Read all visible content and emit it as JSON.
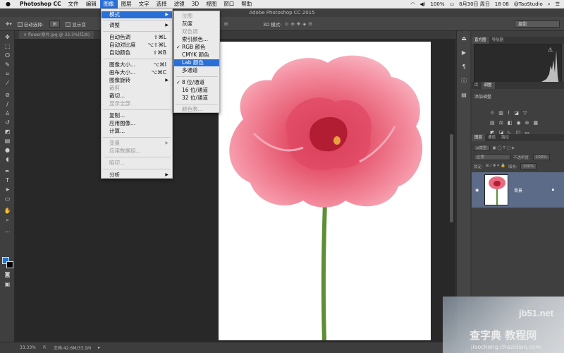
{
  "menubar": {
    "app": "Photoshop CC",
    "items": [
      "文件",
      "编辑",
      "图像",
      "图层",
      "文字",
      "选择",
      "滤镜",
      "3D",
      "视图",
      "窗口",
      "帮助"
    ],
    "status": {
      "battery": "100%",
      "date": "8月30日 周日",
      "time": "18 08",
      "user": "@TaoStudio"
    }
  },
  "titlebar": {
    "title": "Adobe Photoshop CC 2015"
  },
  "options": {
    "auto_select": "自动选择:",
    "show": "显示变",
    "mode3d": "3D 模式:",
    "workspace": "摄影"
  },
  "doc_tab": {
    "label": "flower原片.jpg @ 33.3%(红/8)"
  },
  "image_menu": {
    "items": [
      {
        "label": "模式",
        "shortcut": "",
        "submenu": true
      },
      {
        "label": "调整",
        "shortcut": "",
        "submenu": true
      },
      {
        "label": "自动色调",
        "shortcut": "⇧⌘L"
      },
      {
        "label": "自动对比度",
        "shortcut": "⌥⇧⌘L"
      },
      {
        "label": "自动颜色",
        "shortcut": "⇧⌘B"
      },
      {
        "label": "图像大小...",
        "shortcut": "⌥⌘I"
      },
      {
        "label": "画布大小...",
        "shortcut": "⌥⌘C"
      },
      {
        "label": "图像旋转",
        "shortcut": "",
        "submenu": true
      },
      {
        "label": "裁剪",
        "shortcut": ""
      },
      {
        "label": "裁切...",
        "shortcut": ""
      },
      {
        "label": "显示全部",
        "shortcut": ""
      },
      {
        "label": "复制...",
        "shortcut": ""
      },
      {
        "label": "应用图像...",
        "shortcut": ""
      },
      {
        "label": "计算...",
        "shortcut": ""
      },
      {
        "label": "变量",
        "shortcut": "",
        "submenu": true
      },
      {
        "label": "应用数据组...",
        "shortcut": ""
      },
      {
        "label": "陷印...",
        "shortcut": ""
      },
      {
        "label": "分析",
        "shortcut": "",
        "submenu": true
      }
    ]
  },
  "mode_menu": {
    "items": [
      {
        "label": "位图"
      },
      {
        "label": "灰度"
      },
      {
        "label": "双色调"
      },
      {
        "label": "索引颜色..."
      },
      {
        "label": "RGB 颜色",
        "checked": true
      },
      {
        "label": "CMYK 颜色"
      },
      {
        "label": "Lab 颜色"
      },
      {
        "label": "多通道"
      },
      {
        "label": "8 位/通道",
        "checked": true
      },
      {
        "label": "16 位/通道"
      },
      {
        "label": "32 位/通道"
      },
      {
        "label": "颜色表..."
      }
    ]
  },
  "panels": {
    "histogram_tabs": [
      "直方图",
      "导航器"
    ],
    "adjust_tabs": [
      "库",
      "调整"
    ],
    "adjust_title": "添加调整",
    "layer_tabs": [
      "图层",
      "通道",
      "路径"
    ],
    "kind": "ρ类型",
    "blend": "正常",
    "opacity_label": "不透明度:",
    "opacity": "100%",
    "lock": "锁定:",
    "fill_label": "填充:",
    "fill": "100%",
    "layer_name": "背景"
  },
  "status": {
    "zoom": "33.33%",
    "doc": "文档:42.6M/33.1M"
  },
  "watermark": {
    "site": "jb51.net",
    "text": "查字典 教程网",
    "url": "jiaocheng.chazidian.com"
  }
}
